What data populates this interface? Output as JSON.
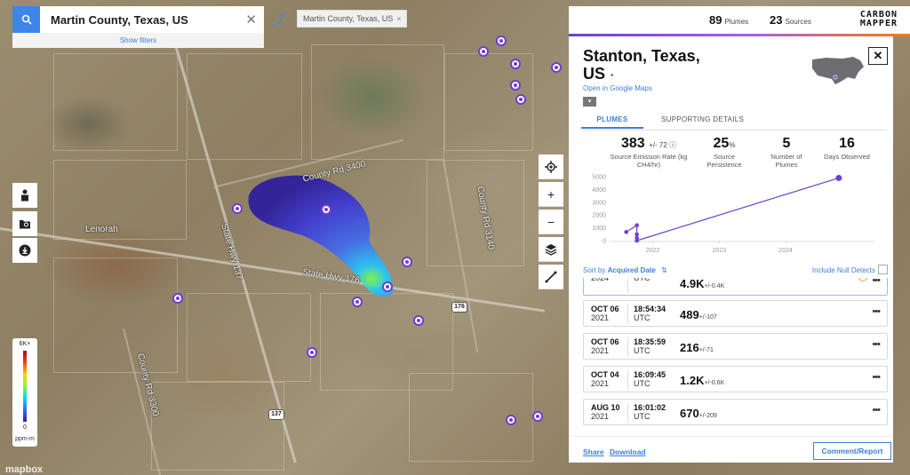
{
  "search": {
    "value": "Martin County, Texas, US",
    "show_filters": "Show filters"
  },
  "chip": {
    "label": "Martin County, Texas, US"
  },
  "stats": {
    "plumes_count": "89",
    "plumes_label": "Plumes",
    "sources_count": "23",
    "sources_label": "Sources"
  },
  "logo": {
    "line1": "CARBON",
    "line2": "MAPPER"
  },
  "map_labels": {
    "town": "Lenorah",
    "county_road_1": "County Rd 3400",
    "county_road_2": "County Rd 3140",
    "state_hwy": "State Hwy 176",
    "state_hwy_137": "State Hwy 137",
    "county_road_3": "County Rd 3300"
  },
  "shields": {
    "a": "176",
    "b": "137"
  },
  "legend": {
    "max": "6K+",
    "min": "0",
    "unit": "ppm-m"
  },
  "mapbox": "mapbox",
  "panel": {
    "title": "Stanton, Texas, US",
    "google_maps": "Open in Google Maps",
    "tabs": [
      "PLUMES",
      "SUPPORTING DETAILS"
    ],
    "kpis": [
      {
        "value": "383",
        "unc": "+/- 72",
        "label": "Source Emission Rate (kg CH4/hr)"
      },
      {
        "value": "25",
        "unc": "%",
        "label": "Source Persistence"
      },
      {
        "value": "5",
        "unc": "",
        "label": "Number of Plumes"
      },
      {
        "value": "16",
        "unc": "",
        "label": "Days Observed"
      }
    ],
    "sort": {
      "label": "Sort by",
      "field": "Acquired Date",
      "null_label": "Include Null Detects"
    },
    "rows": [
      {
        "date": "",
        "year": "2024",
        "time": "",
        "tz": "UTC",
        "value": "4.9K",
        "unc": "+/-0.4K",
        "flag": true
      },
      {
        "date": "OCT 06",
        "year": "2021",
        "time": "18:54:34",
        "tz": "UTC",
        "value": "489",
        "unc": "+/-107"
      },
      {
        "date": "OCT 06",
        "year": "2021",
        "time": "18:35:59",
        "tz": "UTC",
        "value": "216",
        "unc": "+/-71"
      },
      {
        "date": "OCT 04",
        "year": "2021",
        "time": "16:09:45",
        "tz": "UTC",
        "value": "1.2K",
        "unc": "+/-0.6K"
      },
      {
        "date": "AUG 10",
        "year": "2021",
        "time": "16:01:02",
        "tz": "UTC",
        "value": "670",
        "unc": "+/-209"
      }
    ],
    "footer": {
      "share": "Share",
      "download": "Download",
      "comment": "Comment/Report"
    }
  },
  "chart_data": {
    "type": "line",
    "y_ticks": [
      "5000",
      "4000",
      "3000",
      "2000",
      "1000",
      "0"
    ],
    "x_ticks": [
      "2022",
      "2023",
      "2024"
    ],
    "ylim": [
      0,
      5000
    ],
    "xlim": [
      2021.35,
      2025.35
    ],
    "series": [
      {
        "x": [
          2021.6,
          2021.76,
          2021.76,
          2021.76,
          2021.76,
          2024.8
        ],
        "y": [
          670,
          1200,
          216,
          489,
          0,
          4900
        ]
      }
    ],
    "color": "#6d3fd1"
  }
}
